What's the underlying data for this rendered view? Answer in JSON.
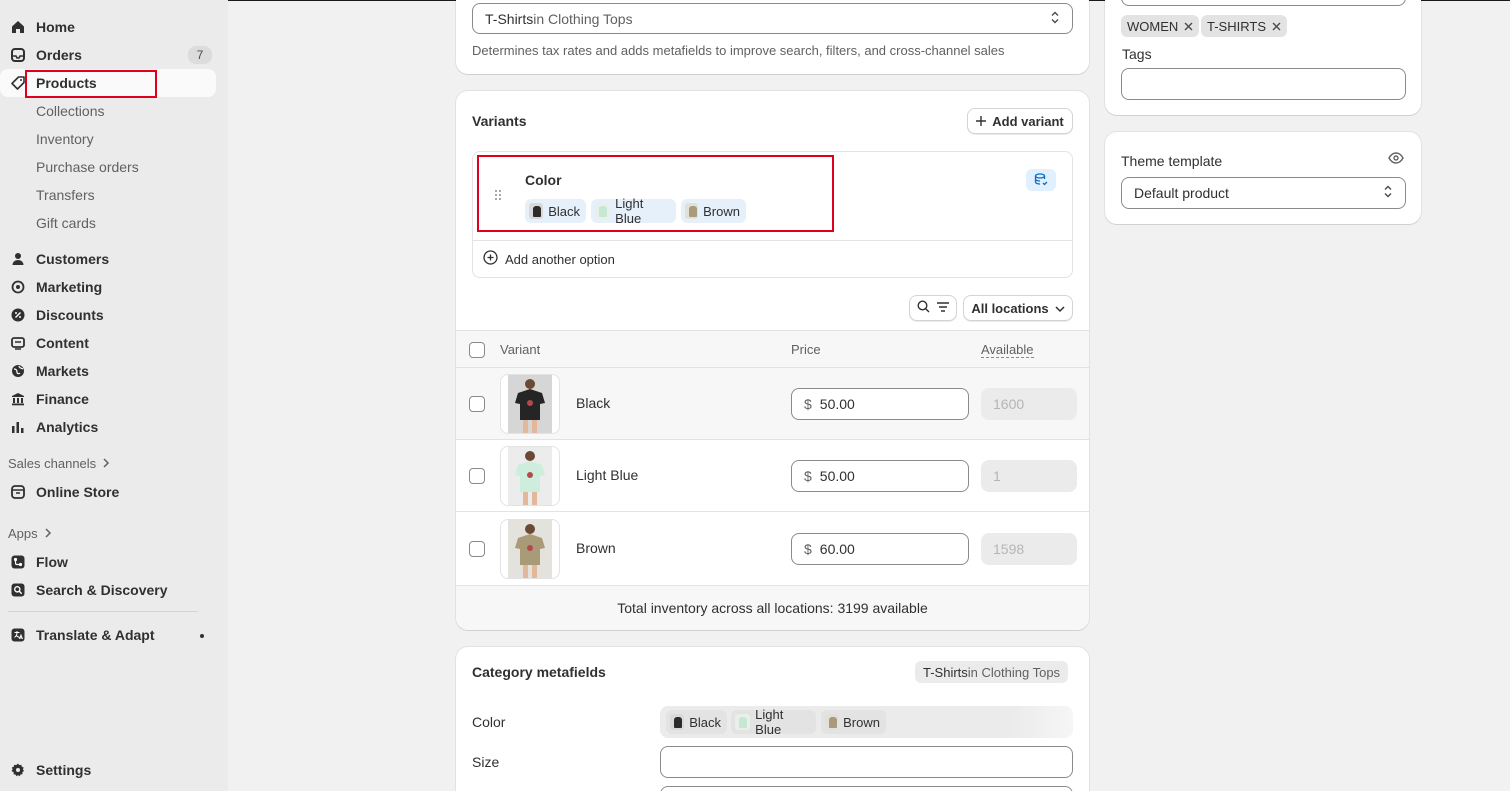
{
  "sidebar": {
    "items": [
      {
        "label": "Home",
        "icon": "home-icon"
      },
      {
        "label": "Orders",
        "icon": "inbox-icon",
        "badge": "7"
      },
      {
        "label": "Products",
        "icon": "tag-icon"
      },
      {
        "label": "Collections"
      },
      {
        "label": "Inventory"
      },
      {
        "label": "Purchase orders"
      },
      {
        "label": "Transfers"
      },
      {
        "label": "Gift cards"
      },
      {
        "label": "Customers",
        "icon": "person-icon"
      },
      {
        "label": "Marketing",
        "icon": "target-icon"
      },
      {
        "label": "Discounts",
        "icon": "discount-icon"
      },
      {
        "label": "Content",
        "icon": "content-icon"
      },
      {
        "label": "Markets",
        "icon": "globe-icon"
      },
      {
        "label": "Finance",
        "icon": "bank-icon"
      },
      {
        "label": "Analytics",
        "icon": "bar-chart-icon"
      }
    ],
    "sales_channels_label": "Sales channels",
    "online_store": "Online Store",
    "apps_label": "Apps",
    "flow": "Flow",
    "search_discovery": "Search & Discovery",
    "translate_adapt": "Translate & Adapt",
    "settings": "Settings"
  },
  "category": {
    "value_main": "T-Shirts",
    "value_rest": " in Clothing Tops",
    "help": "Determines tax rates and adds metafields to improve search, filters, and cross-channel sales"
  },
  "variants": {
    "title": "Variants",
    "add_variant": "Add variant",
    "option_name": "Color",
    "option_values": [
      "Black",
      "Light Blue",
      "Brown"
    ],
    "add_another_option": "Add another option",
    "all_locations": "All locations",
    "columns": {
      "variant": "Variant",
      "price": "Price",
      "available": "Available"
    },
    "rows": [
      {
        "name": "Black",
        "currency": "$",
        "price": "50.00",
        "available": "1600"
      },
      {
        "name": "Light Blue",
        "currency": "$",
        "price": "50.00",
        "available": "1"
      },
      {
        "name": "Brown",
        "currency": "$",
        "price": "60.00",
        "available": "1598"
      }
    ],
    "total": "Total inventory across all locations: 3199 available"
  },
  "category_metafields": {
    "title": "Category metafields",
    "badge_main": "T-Shirts",
    "badge_rest": " in Clothing Tops",
    "color_label": "Color",
    "color_values": [
      "Black",
      "Light Blue",
      "Brown"
    ],
    "size_label": "Size"
  },
  "organization": {
    "tags_list": [
      "WOMEN",
      "T-SHIRTS"
    ],
    "tags_label": "Tags"
  },
  "theme": {
    "label": "Theme template",
    "value": "Default product"
  }
}
